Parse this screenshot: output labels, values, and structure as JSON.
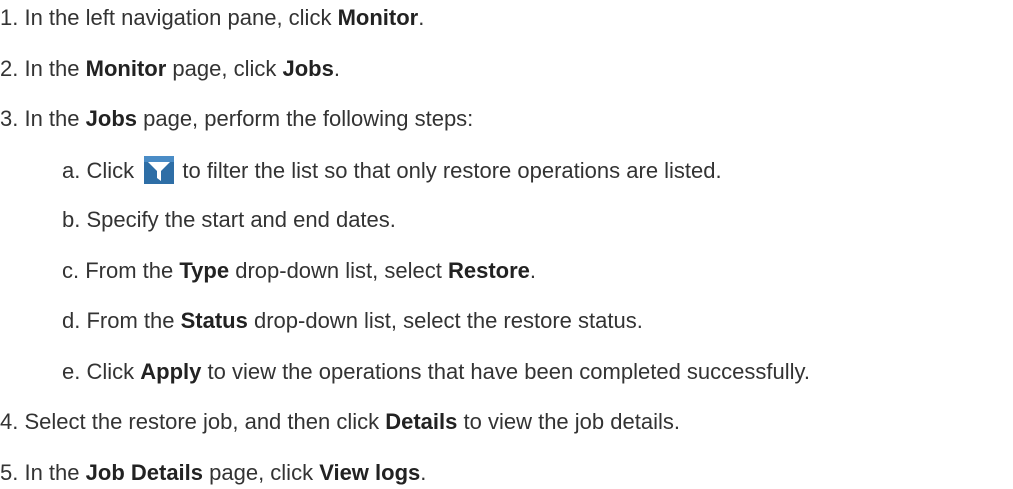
{
  "steps": [
    {
      "num": "1.",
      "parts": [
        {
          "t": " In the left navigation pane, click ",
          "b": false
        },
        {
          "t": "Monitor",
          "b": true
        },
        {
          "t": ".",
          "b": false
        }
      ]
    },
    {
      "num": "2.",
      "parts": [
        {
          "t": " In the ",
          "b": false
        },
        {
          "t": "Monitor",
          "b": true
        },
        {
          "t": " page, click ",
          "b": false
        },
        {
          "t": "Jobs",
          "b": true
        },
        {
          "t": ".",
          "b": false
        }
      ]
    },
    {
      "num": "3.",
      "parts": [
        {
          "t": " In the ",
          "b": false
        },
        {
          "t": "Jobs",
          "b": true
        },
        {
          "t": " page, perform the following steps:",
          "b": false
        }
      ]
    }
  ],
  "substeps": [
    {
      "letter": "a.",
      "before": " Click ",
      "after": " to filter the list so that only restore operations are listed.",
      "icon": "filter-icon"
    },
    {
      "letter": "b.",
      "parts": [
        {
          "t": " Specify the start and end dates.",
          "b": false
        }
      ]
    },
    {
      "letter": "c.",
      "parts": [
        {
          "t": " From the ",
          "b": false
        },
        {
          "t": "Type",
          "b": true
        },
        {
          "t": " drop-down list, select ",
          "b": false
        },
        {
          "t": "Restore",
          "b": true
        },
        {
          "t": ".",
          "b": false
        }
      ]
    },
    {
      "letter": "d.",
      "parts": [
        {
          "t": " From the ",
          "b": false
        },
        {
          "t": "Status",
          "b": true
        },
        {
          "t": " drop-down list, select the restore status.",
          "b": false
        }
      ]
    },
    {
      "letter": "e.",
      "parts": [
        {
          "t": " Click ",
          "b": false
        },
        {
          "t": "Apply",
          "b": true
        },
        {
          "t": " to view the operations that have been completed successfully.",
          "b": false
        }
      ]
    }
  ],
  "steps_after": [
    {
      "num": "4.",
      "parts": [
        {
          "t": " Select the restore job, and then click ",
          "b": false
        },
        {
          "t": "Details",
          "b": true
        },
        {
          "t": " to view the job details.",
          "b": false
        }
      ]
    },
    {
      "num": "5.",
      "parts": [
        {
          "t": " In the ",
          "b": false
        },
        {
          "t": "Job Details",
          "b": true
        },
        {
          "t": " page, click ",
          "b": false
        },
        {
          "t": "View logs",
          "b": true
        },
        {
          "t": ".",
          "b": false
        }
      ]
    }
  ],
  "colors": {
    "text": "#333333",
    "icon_bg": "#2e6ea6",
    "icon_funnel": "#ffffff"
  }
}
